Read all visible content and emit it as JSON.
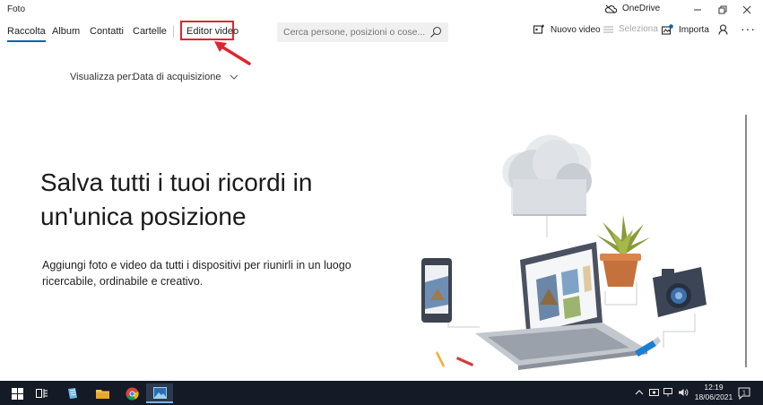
{
  "window": {
    "title": "Foto",
    "onedrive_label": "OneDrive"
  },
  "nav": {
    "items": [
      {
        "label": "Raccolta",
        "active": true
      },
      {
        "label": "Album",
        "active": false
      },
      {
        "label": "Contatti",
        "active": false
      },
      {
        "label": "Cartelle",
        "active": false
      },
      {
        "label": "Editor video",
        "active": false
      }
    ]
  },
  "search": {
    "placeholder": "Cerca persone, posizioni o cose..."
  },
  "toolbar": {
    "new_video_label": "Nuovo video",
    "select_label": "Seleziona",
    "import_label": "Importa"
  },
  "filter": {
    "label": "Visualizza per:",
    "value": "Data di acquisizione"
  },
  "hero": {
    "headline_line1": "Salva tutti i tuoi ricordi in",
    "headline_line2": "un'unica posizione",
    "subtext_line1": "Aggiungi foto e video da tutti i dispositivi per riunirli in un luogo",
    "subtext_line2": "ricercabile, ordinabile e creativo."
  },
  "taskbar": {
    "time": "12:19",
    "date": "18/06/2021",
    "notification_count": "1"
  },
  "colors": {
    "accent": "#0063b1",
    "highlight": "#e0252e",
    "taskbar": "#141a26"
  }
}
